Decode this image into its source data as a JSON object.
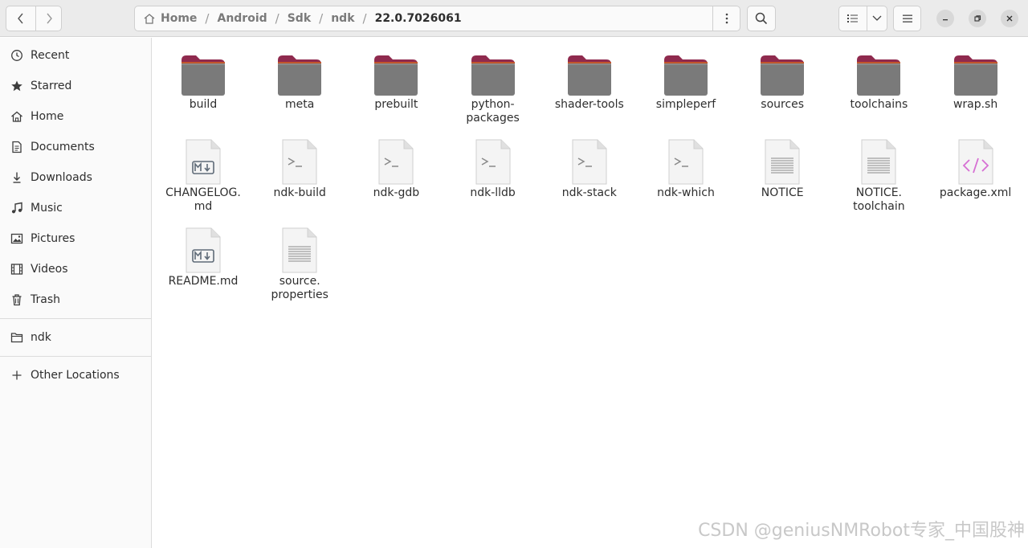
{
  "header": {
    "breadcrumbs": [
      "Home",
      "Android",
      "Sdk",
      "ndk",
      "22.0.7026061"
    ]
  },
  "sidebar": {
    "items": [
      {
        "label": "Recent",
        "icon": "clock-icon"
      },
      {
        "label": "Starred",
        "icon": "star-icon"
      },
      {
        "label": "Home",
        "icon": "home-icon"
      },
      {
        "label": "Documents",
        "icon": "document-icon"
      },
      {
        "label": "Downloads",
        "icon": "download-icon"
      },
      {
        "label": "Music",
        "icon": "music-icon"
      },
      {
        "label": "Pictures",
        "icon": "picture-icon"
      },
      {
        "label": "Videos",
        "icon": "video-icon"
      },
      {
        "label": "Trash",
        "icon": "trash-icon"
      }
    ],
    "bookmarks": [
      {
        "label": "ndk",
        "icon": "folder-icon"
      }
    ],
    "other": {
      "label": "Other Locations",
      "icon": "plus-icon"
    }
  },
  "files": [
    {
      "name": "build",
      "kind": "folder"
    },
    {
      "name": "meta",
      "kind": "folder"
    },
    {
      "name": "prebuilt",
      "kind": "folder"
    },
    {
      "name": "python-\npackages",
      "kind": "folder"
    },
    {
      "name": "shader-tools",
      "kind": "folder"
    },
    {
      "name": "simpleperf",
      "kind": "folder"
    },
    {
      "name": "sources",
      "kind": "folder"
    },
    {
      "name": "toolchains",
      "kind": "folder"
    },
    {
      "name": "wrap.sh",
      "kind": "folder"
    },
    {
      "name": "CHANGELOG.\nmd",
      "kind": "markdown"
    },
    {
      "name": "ndk-build",
      "kind": "script"
    },
    {
      "name": "ndk-gdb",
      "kind": "script"
    },
    {
      "name": "ndk-lldb",
      "kind": "script"
    },
    {
      "name": "ndk-stack",
      "kind": "script"
    },
    {
      "name": "ndk-which",
      "kind": "script"
    },
    {
      "name": "NOTICE",
      "kind": "text"
    },
    {
      "name": "NOTICE.\ntoolchain",
      "kind": "text"
    },
    {
      "name": "package.xml",
      "kind": "xml"
    },
    {
      "name": "README.md",
      "kind": "markdown"
    },
    {
      "name": "source.\nproperties",
      "kind": "text"
    }
  ],
  "watermark": "CSDN @geniusNMRobot专家_中国股神",
  "colors": {
    "folder_body": "#7a7a7a",
    "folder_tab": "#8f2a4e",
    "accent": "#e95420"
  }
}
